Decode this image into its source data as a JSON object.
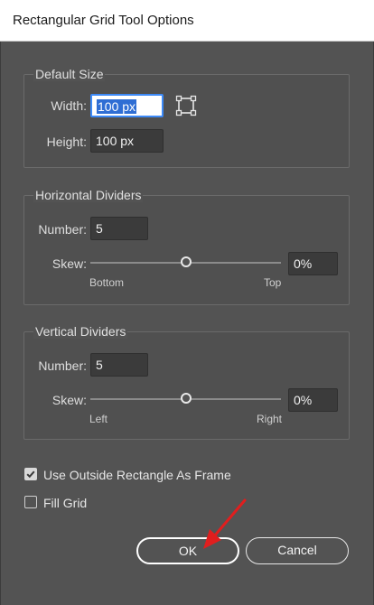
{
  "window": {
    "title": "Rectangular Grid Tool Options"
  },
  "default_size": {
    "label": "Default Size",
    "width_label": "Width:",
    "width_value": "100 px",
    "height_label": "Height:",
    "height_value": "100 px",
    "reference_point_icon": "reference-point-icon"
  },
  "horizontal_dividers": {
    "label": "Horizontal Dividers",
    "number_label": "Number:",
    "number_value": "5",
    "skew_label": "Skew:",
    "skew_value": "0%",
    "skew_level": 0.5,
    "left_caption": "Bottom",
    "right_caption": "Top"
  },
  "vertical_dividers": {
    "label": "Vertical Dividers",
    "number_label": "Number:",
    "number_value": "5",
    "skew_label": "Skew:",
    "skew_value": "0%",
    "skew_level": 0.5,
    "left_caption": "Left",
    "right_caption": "Right"
  },
  "options": {
    "use_outside_label": "Use Outside Rectangle As Frame",
    "use_outside_checked": true,
    "fill_grid_label": "Fill Grid",
    "fill_grid_checked": false
  },
  "buttons": {
    "ok_label": "OK",
    "cancel_label": "Cancel"
  },
  "colors": {
    "dialog_bg": "#535353",
    "accent": "#3d8af7",
    "annotation_arrow": "#e01e1e"
  }
}
